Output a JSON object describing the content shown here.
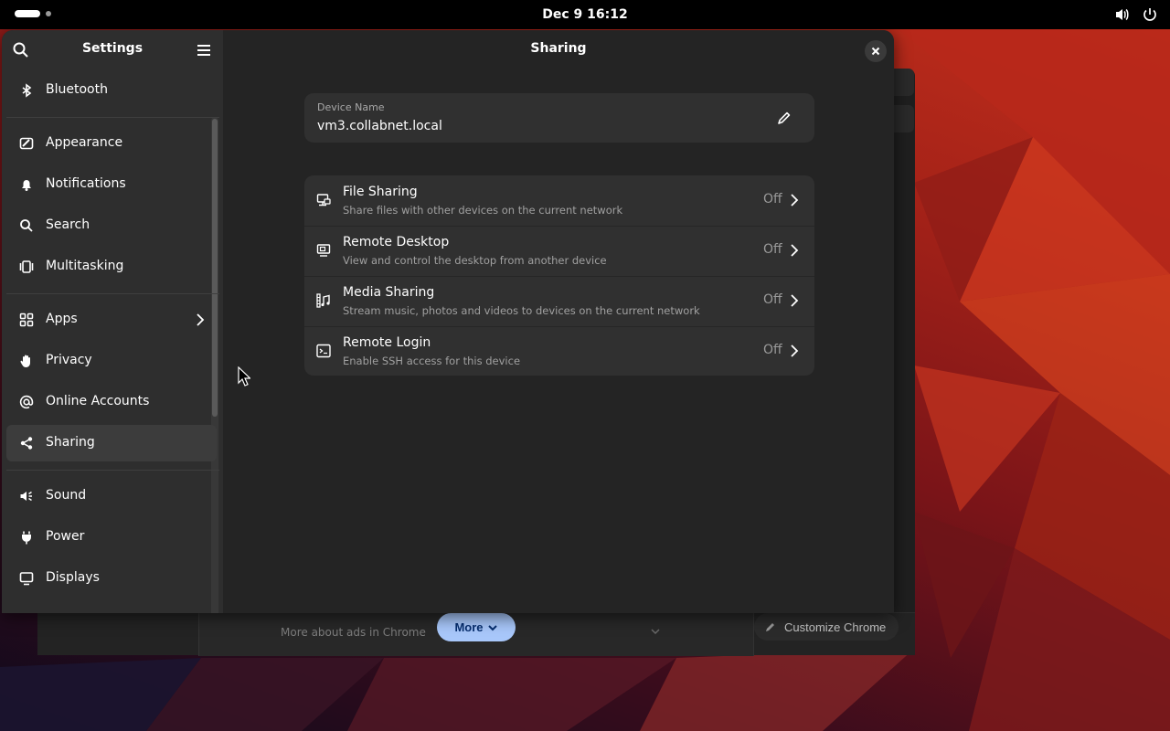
{
  "topbar": {
    "clock": "Dec 9  16:12"
  },
  "chrome_bg": {
    "ads_link": "More about ads in Chrome",
    "more_button": "More",
    "customize_button": "Customize Chrome"
  },
  "sidebar": {
    "title": "Settings",
    "items": [
      {
        "label": "Bluetooth",
        "icon": "bluetooth-icon"
      },
      {
        "label": "Appearance",
        "icon": "appearance-icon"
      },
      {
        "label": "Notifications",
        "icon": "bell-icon"
      },
      {
        "label": "Search",
        "icon": "search-icon"
      },
      {
        "label": "Multitasking",
        "icon": "multitasking-icon"
      },
      {
        "label": "Apps",
        "icon": "apps-icon"
      },
      {
        "label": "Privacy",
        "icon": "hand-icon"
      },
      {
        "label": "Online Accounts",
        "icon": "at-icon"
      },
      {
        "label": "Sharing",
        "icon": "share-icon"
      },
      {
        "label": "Sound",
        "icon": "sound-icon"
      },
      {
        "label": "Power",
        "icon": "power-plug-icon"
      },
      {
        "label": "Displays",
        "icon": "display-icon"
      }
    ],
    "selected": "Sharing"
  },
  "content": {
    "title": "Sharing",
    "device": {
      "label": "Device Name",
      "value": "vm3.collabnet.local"
    },
    "rows": [
      {
        "title": "File Sharing",
        "subtitle": "Share files with other devices on the current network",
        "status": "Off"
      },
      {
        "title": "Remote Desktop",
        "subtitle": "View and control the desktop from another device",
        "status": "Off"
      },
      {
        "title": "Media Sharing",
        "subtitle": "Stream music, photos and videos to devices on the current network",
        "status": "Off"
      },
      {
        "title": "Remote Login",
        "subtitle": "Enable SSH access for this device",
        "status": "Off"
      }
    ]
  },
  "colors": {
    "accent_blue": "#a8c7fa",
    "window_bg": "#242424",
    "sidebar_bg": "#2e2e2e",
    "card_bg": "#303030"
  }
}
